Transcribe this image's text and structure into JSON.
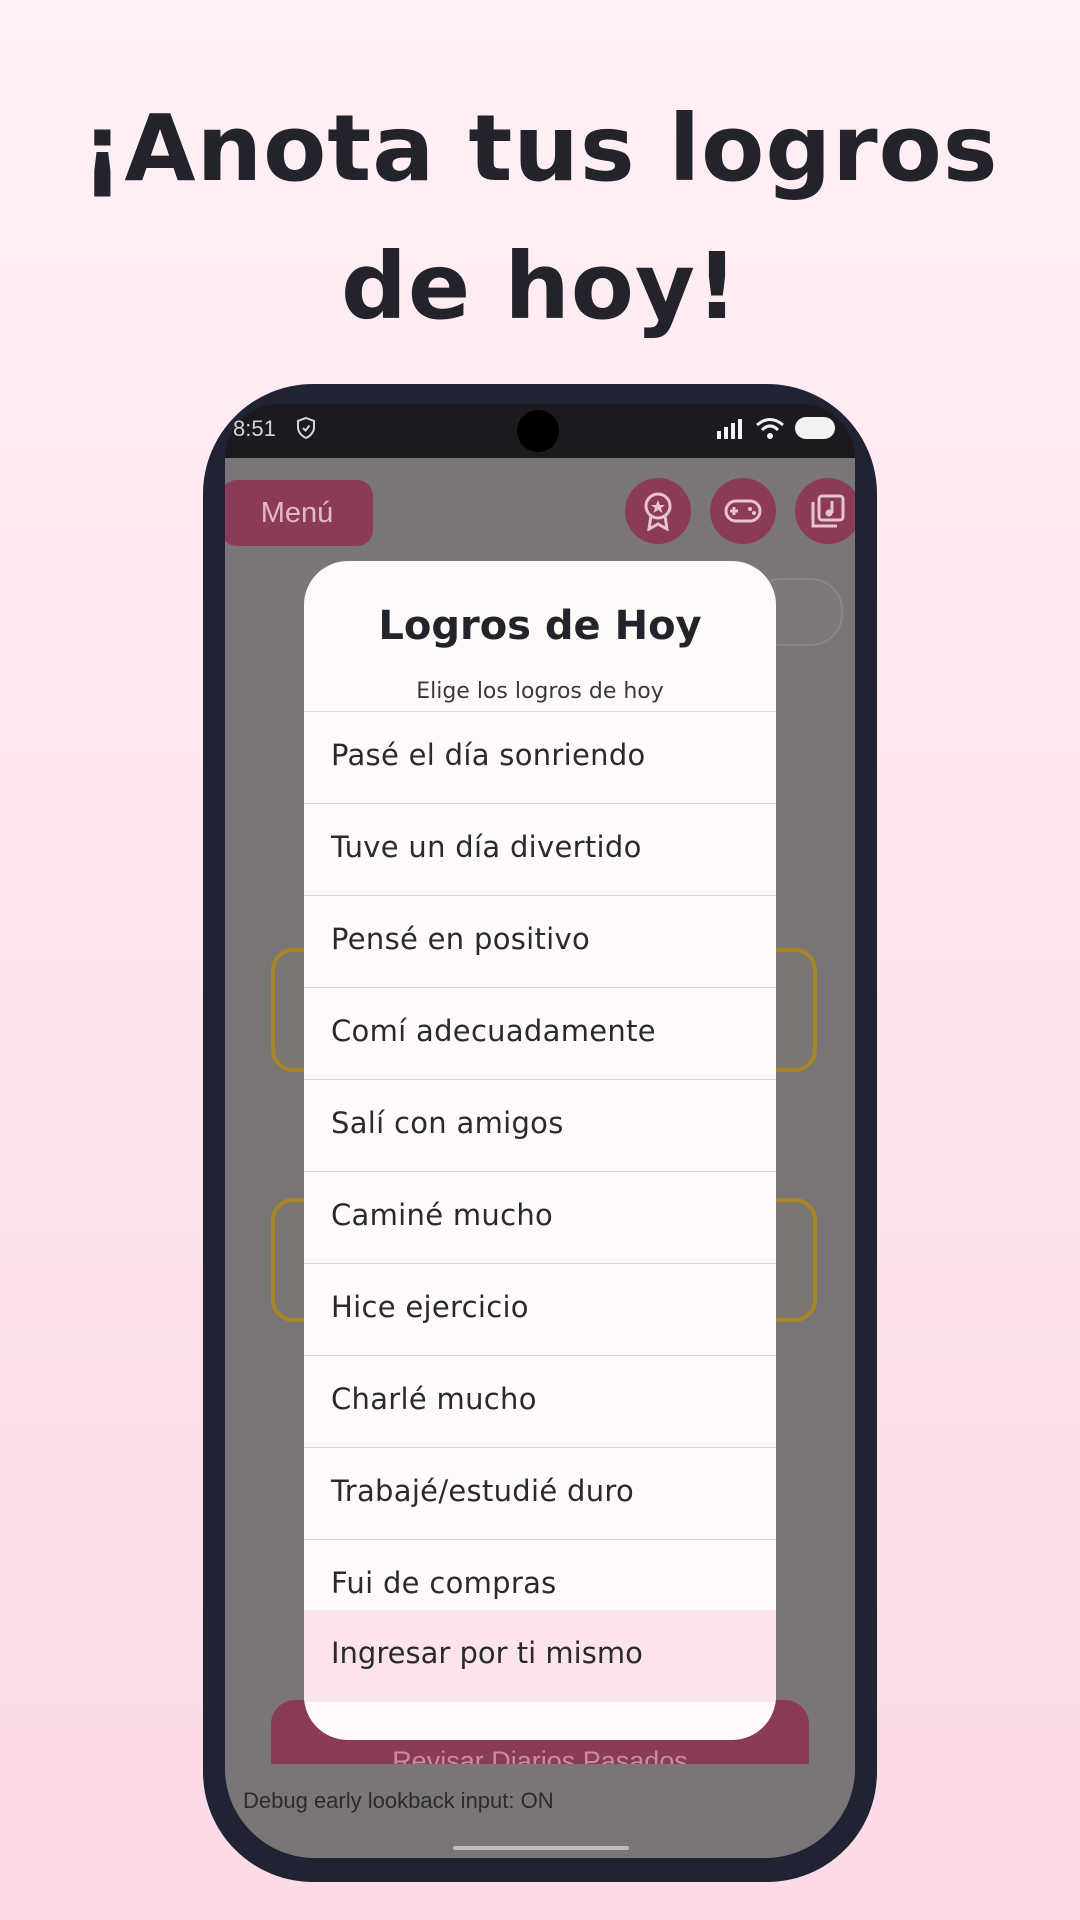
{
  "headline": {
    "line1": "¡Anota tus logros",
    "line2": "de hoy!"
  },
  "status_bar": {
    "time": "8:51",
    "icons": [
      "shield-icon",
      "signal-icon",
      "wifi-icon",
      "battery-icon"
    ]
  },
  "app_bar": {
    "menu_label": "Menú",
    "buttons": [
      "award-icon",
      "gamepad-icon",
      "music-library-icon"
    ]
  },
  "background": {
    "review_button_label": "Revisar Diarios Pasados",
    "debug_text": "Debug early lookback input: ON"
  },
  "dialog": {
    "title": "Logros de Hoy",
    "subtitle": "Elige los logros de hoy",
    "options": [
      "Pasé el día sonriendo",
      "Tuve un día divertido",
      "Pensé en positivo",
      "Comí adecuadamente",
      "Salí con amigos",
      "Caminé mucho",
      "Hice ejercicio",
      "Charlé mucho",
      "Trabajé/estudié duro",
      "Fui de compras"
    ],
    "manual_entry_label": "Ingresar por ti mismo"
  },
  "colors": {
    "accent": "#c2446f",
    "dimmed_accent": "#8b3b57",
    "dialog_bg": "#fefafa",
    "manual_entry_bg": "#fde4ea",
    "phone_frame": "#1f2333"
  }
}
